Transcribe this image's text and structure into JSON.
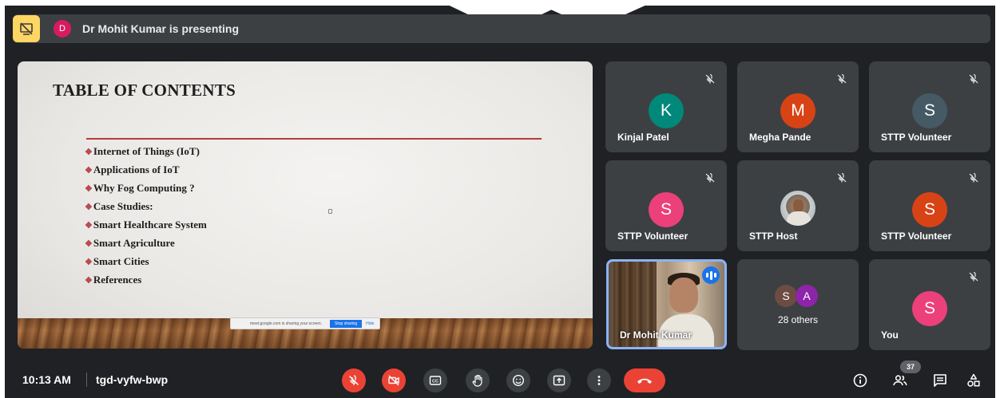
{
  "presenting_bar": {
    "presenter_initial": "D",
    "presenter_color": "#d81b60",
    "text": "Dr Mohit Kumar is presenting",
    "stop_icon": "stop-presenting-icon",
    "stop_color": "#fdd663"
  },
  "slide": {
    "title": "TABLE OF CONTENTS",
    "bullet": "❖",
    "items": [
      "Internet of Things (IoT)",
      "Applications of IoT",
      "Why Fog Computing ?",
      "Case Studies:",
      "Smart Healthcare System",
      "Smart Agriculture",
      "Smart Cities",
      "References"
    ],
    "share_notice": {
      "message": "meet.google.com is sharing your screen.",
      "stop_label": "Stop sharing",
      "hide_label": "Hide"
    }
  },
  "participants": [
    {
      "name": "Kinjal Patel",
      "initial": "K",
      "color": "#00897b",
      "muted": true
    },
    {
      "name": "Megha Pande",
      "initial": "M",
      "color": "#d84315",
      "muted": true
    },
    {
      "name": "STTP Volunteer",
      "initial": "S",
      "color": "#455a64",
      "muted": true
    },
    {
      "name": "STTP Volunteer",
      "initial": "S",
      "color": "#ec407a",
      "muted": true
    },
    {
      "name": "STTP Host",
      "initial": "",
      "color": "#9aa5ad",
      "muted": true
    },
    {
      "name": "STTP Volunteer",
      "initial": "S",
      "color": "#d84315",
      "muted": true
    },
    {
      "name": "Dr Mohit Kumar",
      "speaking": true
    },
    {
      "name": "28 others",
      "initials": [
        "S",
        "A"
      ],
      "colors": [
        "#6d4c41",
        "#8e24aa"
      ]
    },
    {
      "name": "You",
      "initial": "S",
      "color": "#ec407a",
      "muted": true
    }
  ],
  "bottom_bar": {
    "time": "10:13 AM",
    "meeting_code": "tgd-vyfw-bwp",
    "people_count": "37",
    "controls": [
      "mic-off-icon",
      "camera-off-icon",
      "captions-icon",
      "raise-hand-icon",
      "emoji-icon",
      "present-icon",
      "more-options-icon",
      "end-call-icon"
    ],
    "right_controls": [
      "info-icon",
      "people-icon",
      "chat-icon",
      "activities-icon"
    ],
    "accent_red": "#ea4335"
  }
}
